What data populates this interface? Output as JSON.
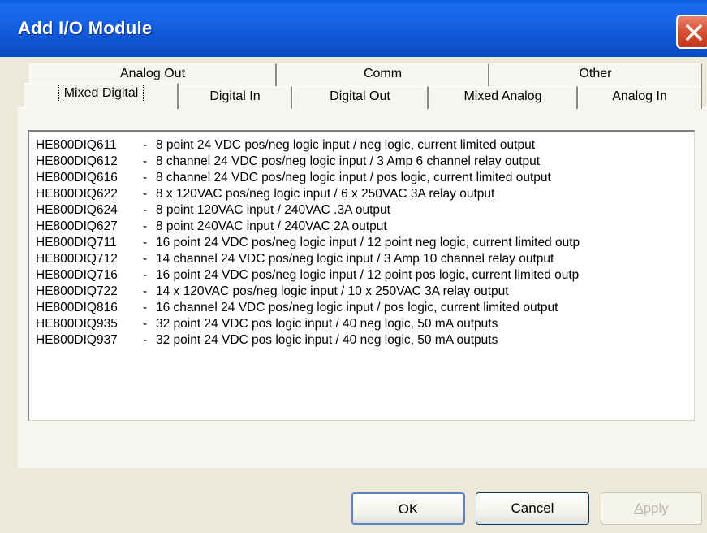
{
  "window": {
    "title": "Add I/O Module"
  },
  "tabs": {
    "row_back": [
      {
        "label": "Analog Out"
      },
      {
        "label": "Comm"
      },
      {
        "label": "Other"
      }
    ],
    "row_front": [
      {
        "label": "Mixed Digital",
        "selected": true
      },
      {
        "label": "Digital In"
      },
      {
        "label": "Digital Out"
      },
      {
        "label": "Mixed Analog"
      },
      {
        "label": "Analog In"
      }
    ]
  },
  "module_list": {
    "items": [
      {
        "code": "HE800DIQ611",
        "sep": "-",
        "desc": "8 point 24 VDC pos/neg logic input / neg logic, current limited output"
      },
      {
        "code": "HE800DIQ612",
        "sep": "-",
        "desc": "8 channel 24 VDC pos/neg logic input / 3 Amp 6 channel relay output"
      },
      {
        "code": "HE800DIQ616",
        "sep": "-",
        "desc": "8 channel 24 VDC pos/neg logic input / pos logic, current limited output"
      },
      {
        "code": "HE800DIQ622",
        "sep": "-",
        "desc": "8 x 120VAC pos/neg logic input / 6 x 250VAC 3A relay output"
      },
      {
        "code": "HE800DIQ624",
        "sep": "-",
        "desc": "8 point 120VAC input / 240VAC .3A output"
      },
      {
        "code": "HE800DIQ627",
        "sep": "-",
        "desc": "8 point 240VAC input / 240VAC 2A output"
      },
      {
        "code": "HE800DIQ711",
        "sep": "-",
        "desc": "16 point 24 VDC pos/neg logic input / 12 point neg logic, current limited outp"
      },
      {
        "code": "HE800DIQ712",
        "sep": "-",
        "desc": "14 channel 24 VDC pos/neg logic input / 3 Amp 10 channel relay output"
      },
      {
        "code": "HE800DIQ716",
        "sep": "-",
        "desc": "16 point 24 VDC pos/neg logic input / 12 point pos logic, current limited outp"
      },
      {
        "code": "HE800DIQ722",
        "sep": "-",
        "desc": "14 x 120VAC pos/neg logic input / 10 x 250VAC 3A relay output"
      },
      {
        "code": "HE800DIQ816",
        "sep": "-",
        "desc": "16 channel 24 VDC pos/neg logic input / pos logic, current limited output"
      },
      {
        "code": "HE800DIQ935",
        "sep": "-",
        "desc": "32 point 24 VDC pos logic input / 40 neg logic, 50 mA outputs"
      },
      {
        "code": "HE800DIQ937",
        "sep": "-",
        "desc": "32 point 24 VDC pos logic input / 40 neg logic, 50 mA outputs"
      }
    ]
  },
  "buttons": {
    "ok": "OK",
    "cancel": "Cancel",
    "apply_accel": "A",
    "apply_rest": "pply"
  },
  "icons": {
    "close": "close-icon"
  },
  "colors": {
    "titlebar": "#0f55d3",
    "close_button": "#d8553a",
    "dialog_face": "#ece9d8",
    "tab_face": "#f6f5ef"
  }
}
